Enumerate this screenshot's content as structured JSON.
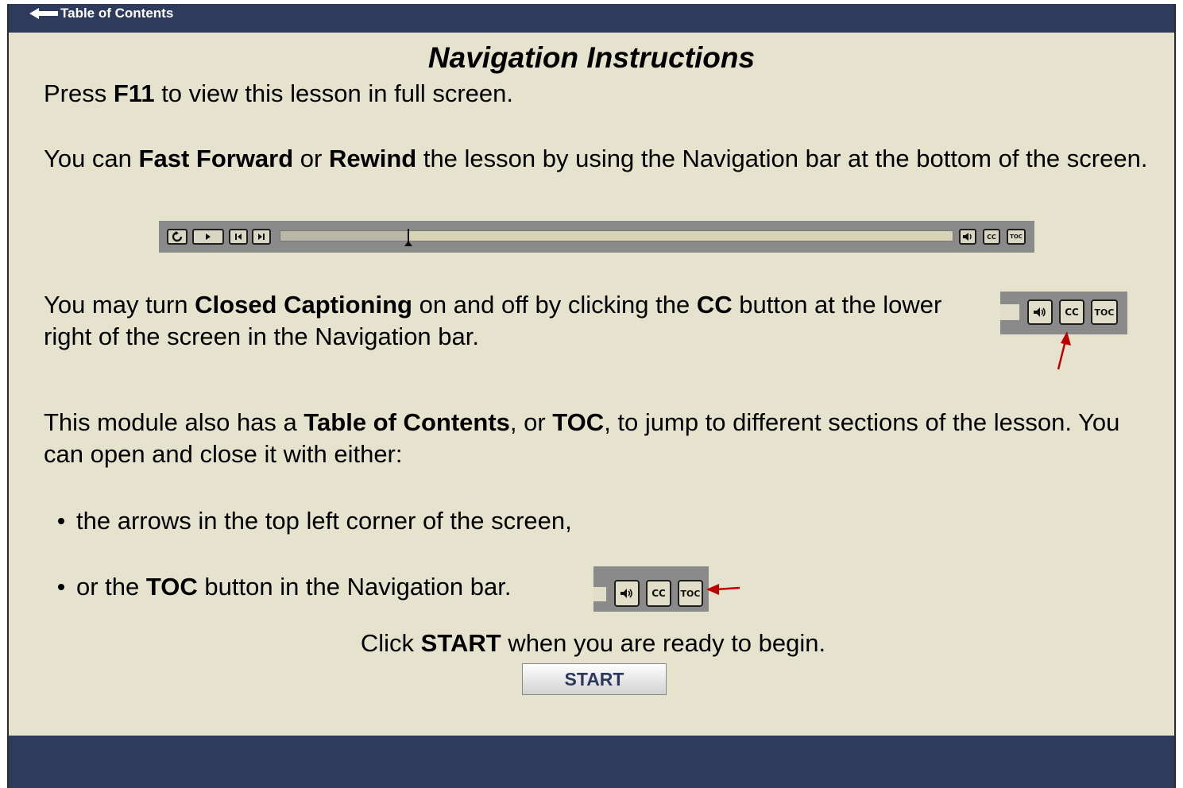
{
  "header": {
    "toc_label": "Table of Contents"
  },
  "title": "Navigation Instructions",
  "p1": {
    "a": "Press ",
    "b1": "F11",
    "c": " to view this lesson in full screen."
  },
  "p2": {
    "a": "You can ",
    "b1": "Fast Forward",
    "c": " or ",
    "b2": "Rewind",
    "d": " the lesson by using the Navigation bar at the bottom of the screen."
  },
  "p3": {
    "a": "You may turn ",
    "b1": "Closed Captioning",
    "c": " on and off by clicking the ",
    "b2": "CC",
    "d": " button at the lower right of the screen in the Navigation bar."
  },
  "p4": {
    "a": "This module also has a ",
    "b1": "Table of Contents",
    "c": ", or ",
    "b2": "TOC",
    "d": ", to jump to different sections of the lesson. You can open and close it with either:"
  },
  "bullet1": "the arrows in the top left corner of the screen,",
  "bullet2": {
    "a": "or the ",
    "b1": "TOC",
    "c": " button in the Navigation bar."
  },
  "p5": {
    "a": "Click ",
    "b1": "START",
    "c": " when you are ready to begin."
  },
  "start_label": "START",
  "navbar": {
    "cc": "CC",
    "toc": "TOC",
    "progress_fraction": 0.19
  },
  "colors": {
    "bar": "#2f3b5c",
    "page": "#e5e3cd",
    "arrow": "#c00000"
  }
}
